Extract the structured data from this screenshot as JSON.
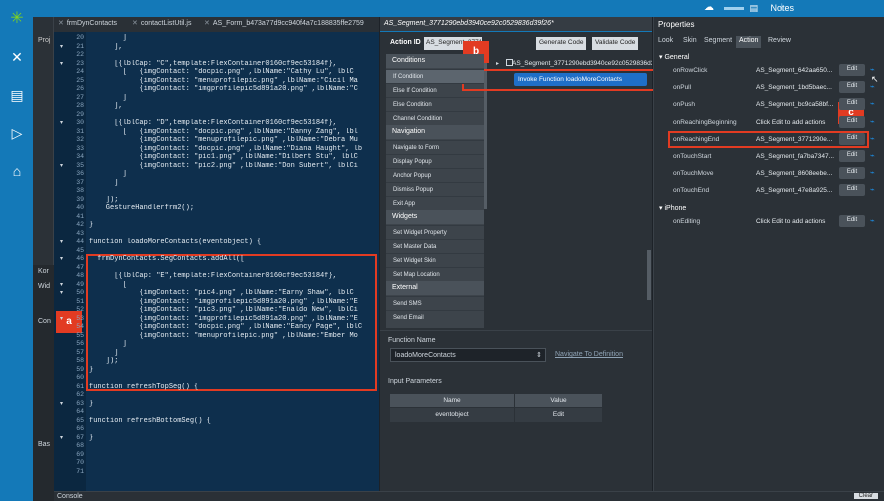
{
  "topbar": {
    "notes_label": "Notes"
  },
  "rail": {
    "icons": [
      "kony-logo-icon",
      "tools-icon",
      "document-icon",
      "preview-icon",
      "store-icon"
    ]
  },
  "project_panel": {
    "title": "Proj",
    "bottom_title": "Kor",
    "widgets": "Wid",
    "controls": "Con",
    "basic": "Bas"
  },
  "editor": {
    "tabs": [
      {
        "label": "frmDynContacts"
      },
      {
        "label": "contactListUtil.js"
      },
      {
        "label": "AS_Form_b473a77d9cc940f4a7c188835ffe2759"
      }
    ],
    "line_numbers": [
      "20",
      "21",
      "22",
      "23",
      "24",
      "25",
      "26",
      "27",
      "28",
      "29",
      "30",
      "31",
      "32",
      "33",
      "34",
      "35",
      "36",
      "37",
      "38",
      "39",
      "40",
      "41",
      "42",
      "43",
      "44",
      "45",
      "46",
      "47",
      "48",
      "49",
      "50",
      "51",
      "52",
      "53",
      "54",
      "55",
      "56",
      "57",
      "58",
      "59",
      "60",
      "61",
      "62",
      "63",
      "64",
      "65",
      "66",
      "67",
      "68",
      "69",
      "70",
      "71"
    ],
    "lines": [
      "        ]",
      "      ],",
      "",
      "      [{lblCap: \"C\",template:FlexContainer0160cf9ec53184f},",
      "        [   {imgContact: \"docpic.png\" ,lblName:\"Cathy Lu\", lblC",
      "            {imgContact: \"menuprofilepic.png\" ,lblName:\"Cicil Ma",
      "            {imgContact: \"imgprofilepic5d891a20.png\" ,lblName:\"C",
      "        ]",
      "      ],",
      "",
      "      [{lblCap: \"D\",template:FlexContainer0160cf9ec53184f},",
      "        [   {imgContact: \"docpic.png\" ,lblName:\"Danny Zang\", lbl",
      "            {imgContact: \"menuprofilepic.png\" ,lblName:\"Debra Mu",
      "            {imgContact: \"docpic.png\" ,lblName:\"Diana Haught\", lb",
      "            {imgContact: \"pic1.png\" ,lblName:\"Dilbert Stu\", lblC",
      "            {imgContact: \"pic2.png\" ,lblName:\"Don Subert\", lblCi",
      "        ]",
      "      ]",
      "",
      "    ]);",
      "    GestureHandlerfrm2();",
      "",
      "}",
      "",
      "function loadoMoreContacts(eventobject) {",
      "",
      "  frmDynContacts.SegContacts.addAll([",
      "",
      "      [{lblCap: \"E\",template:FlexContainer0160cf9ec53184f},",
      "        [",
      "            {imgContact: \"pic4.png\" ,lblName:\"Earny Shaw\", lblC",
      "            {imgContact: \"imgprofilepic5d891a20.png\" ,lblName:\"E",
      "            {imgContact: \"pic3.png\" ,lblName:\"Enaldo New\", lblCi",
      "            {imgContact: \"imgprofilepic5d891a20.png\" ,lblName:\"E",
      "            {imgContact: \"docpic.png\" ,lblName:\"Eancy Page\", lblC",
      "            {imgContact: \"menuprofilepic.png\" ,lblName:\"Ember Mo",
      "        ]",
      "      ]",
      "    ]);",
      "}",
      "",
      "function refreshTopSeg() {",
      "",
      "}",
      "",
      "function refreshBottomSeg() {",
      "",
      "}",
      "",
      "",
      "",
      ""
    ],
    "badge_a": "a"
  },
  "action_editor": {
    "tab_title": "AS_Segment_3771290ebd3940ce92c0529836d39f26*",
    "action_id_label": "Action ID",
    "action_id_value": "AS_Segment_3771290ebd3940ce",
    "generate_code": "Generate Code",
    "validate_code": "Validate Code",
    "palette": {
      "conditions": "Conditions",
      "condition_items": [
        "If Condition",
        "Else If Condition",
        "Else Condition",
        "Channel Condition"
      ],
      "navigation": "Navigation",
      "navigation_items": [
        "Navigate to Form",
        "Display Popup",
        "Anchor Popup",
        "Dismiss Popup",
        "Exit App"
      ],
      "widgets": "Widgets",
      "widget_items": [
        "Set Widget Property",
        "Set Master Data",
        "Set Widget Skin",
        "Set Map Location"
      ],
      "external": "External",
      "external_items": [
        "Send SMS",
        "Send Email"
      ]
    },
    "segment_node": "AS_Segment_3771290ebd3940ce92c0529836d39f26",
    "invoke_label": "Invoke Function loadoMoreContacts",
    "badge_b": "b",
    "function_name_label": "Function Name",
    "function_name_value": "loadoMoreContacts",
    "navigate_definition": "Navigate To Definition",
    "input_params_label": "Input Parameters",
    "table_headers": [
      "Name",
      "Value"
    ],
    "table_rows": [
      {
        "name": "eventobject",
        "value": "Edit"
      }
    ]
  },
  "properties": {
    "title": "Properties",
    "tabs": [
      "Look",
      "Skin",
      "Segment",
      "Action",
      "Review"
    ],
    "active_tab": "Action",
    "general_label": "General",
    "iphone_label": "iPhone",
    "rows": [
      {
        "name": "onRowClick",
        "value": "AS_Segment_642aa650...",
        "edit": "Edit"
      },
      {
        "name": "onPull",
        "value": "AS_Segment_1bd5baec...",
        "edit": "Edit"
      },
      {
        "name": "onPush",
        "value": "AS_Segment_bc9ca58bf...",
        "edit": "Edit"
      },
      {
        "name": "onReachingBeginning",
        "value": "Click Edit to add actions",
        "edit": "Edit"
      },
      {
        "name": "onReachingEnd",
        "value": "AS_Segment_3771290e...",
        "edit": "Edit"
      },
      {
        "name": "onTouchStart",
        "value": "AS_Segment_fa7ba7347...",
        "edit": "Edit"
      },
      {
        "name": "onTouchMove",
        "value": "AS_Segment_8608eebe...",
        "edit": "Edit"
      },
      {
        "name": "onTouchEnd",
        "value": "AS_Segment_47e8a925...",
        "edit": "Edit"
      }
    ],
    "iphone_rows": [
      {
        "name": "onEditing",
        "value": "Click Edit to add actions",
        "edit": "Edit"
      }
    ],
    "badge_c": "c"
  },
  "console": {
    "title": "Console",
    "clear": "Clear"
  },
  "colors": {
    "accent": "#1479b8",
    "highlight": "#e23b22",
    "editor_bg": "#0e2f4d"
  }
}
